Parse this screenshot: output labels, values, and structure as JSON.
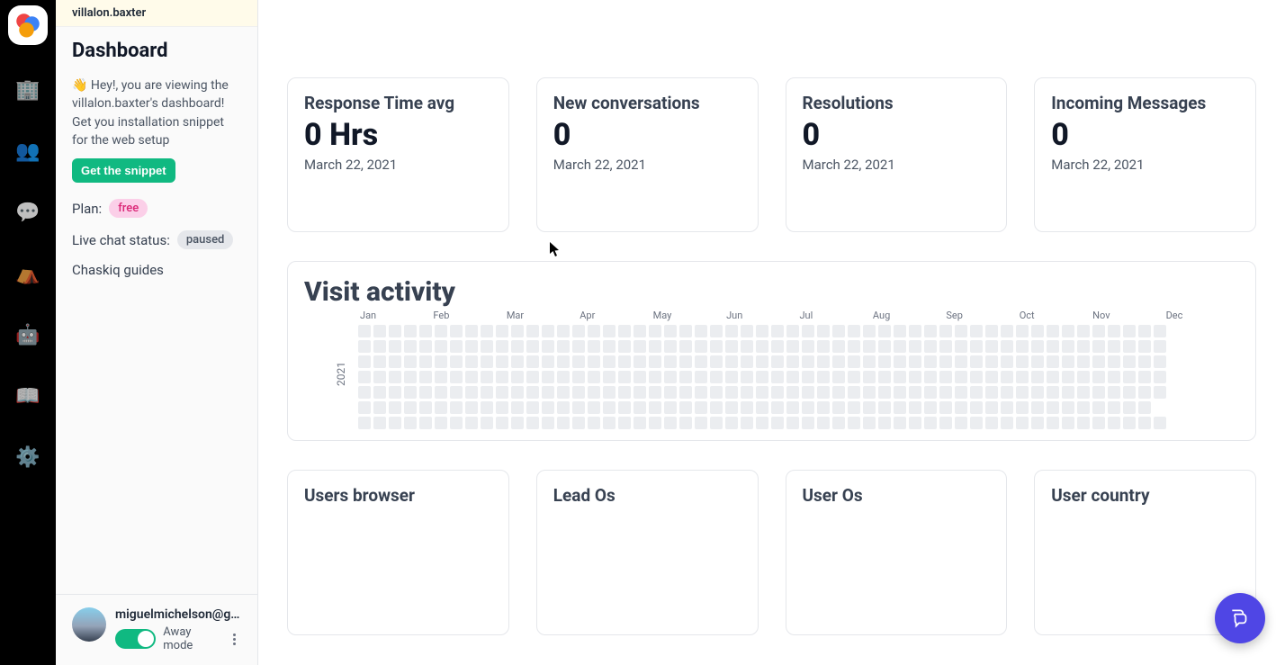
{
  "rail": {
    "items": [
      {
        "name": "building-icon",
        "glyph": "🏢"
      },
      {
        "name": "people-icon",
        "glyph": "👥"
      },
      {
        "name": "chat-icon",
        "glyph": "💬"
      },
      {
        "name": "campaigns-icon",
        "glyph": "⛺"
      },
      {
        "name": "bot-icon",
        "glyph": "🤖"
      },
      {
        "name": "docs-icon",
        "glyph": "📖"
      },
      {
        "name": "settings-icon",
        "glyph": "⚙️"
      }
    ]
  },
  "sidebar": {
    "app_name": "villalon.baxter",
    "title": "Dashboard",
    "greeting_prefix": "👋  Hey!, you are viewing the ",
    "greeting_app_part": "villalon.baxter's dashboard!",
    "greeting_suffix": " Get you installation snippet for the web setup",
    "snippet_button": "Get the snippet",
    "plan_label": "Plan:",
    "plan_value": "free",
    "status_label": "Live chat status:",
    "status_value": "paused",
    "guides_label": "Chaskiq guides"
  },
  "user": {
    "email": "miguelmichelson@g...",
    "away_label": "Away mode"
  },
  "cards": [
    {
      "title": "Response Time avg",
      "value": "0 Hrs",
      "date": "March 22, 2021"
    },
    {
      "title": "New conversations",
      "value": "0",
      "date": "March 22, 2021"
    },
    {
      "title": "Resolutions",
      "value": "0",
      "date": "March 22, 2021"
    },
    {
      "title": "Incoming Messages",
      "value": "0",
      "date": "March 22, 2021"
    }
  ],
  "visit": {
    "title": "Visit activity",
    "year": "2021",
    "months": [
      "Jan",
      "Feb",
      "Mar",
      "Apr",
      "May",
      "Jun",
      "Jul",
      "Aug",
      "Sep",
      "Oct",
      "Nov",
      "Dec"
    ]
  },
  "bottom_cards": [
    {
      "title": "Users browser"
    },
    {
      "title": "Lead Os"
    },
    {
      "title": "User Os"
    },
    {
      "title": "User country"
    }
  ],
  "chart_data": {
    "type": "heatmap",
    "title": "Visit activity",
    "year": 2021,
    "months": [
      "Jan",
      "Feb",
      "Mar",
      "Apr",
      "May",
      "Jun",
      "Jul",
      "Aug",
      "Sep",
      "Oct",
      "Nov",
      "Dec"
    ],
    "rows": 7,
    "columns": 53,
    "values_note": "All cells empty / zero (no activity shown)",
    "min": 0,
    "max": 0
  }
}
